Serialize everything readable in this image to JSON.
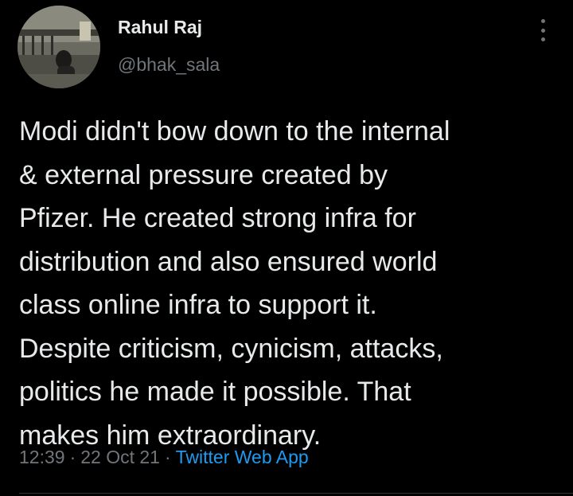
{
  "author": {
    "display_name": "Rahul Raj",
    "handle": "@bhak_sala",
    "avatar_icon": "profile-photo"
  },
  "menu": {
    "icon": "more-vertical-icon"
  },
  "tweet": {
    "lines": [
      "Modi didn't bow down to the internal",
      "& external pressure created by",
      "Pfizer. He created strong infra for",
      "distribution and also ensured world",
      "class online infra to support it.",
      "Despite criticism, cynicism, attacks,",
      "politics he made it possible. That",
      "makes him extraordinary."
    ]
  },
  "meta": {
    "time": "12:39",
    "separator": "·",
    "date": "22 Oct 21",
    "source": "Twitter Web App"
  },
  "colors": {
    "background": "#000000",
    "text_primary": "#e7e9ea",
    "text_secondary": "#71767b",
    "link": "#1d9bf0"
  }
}
